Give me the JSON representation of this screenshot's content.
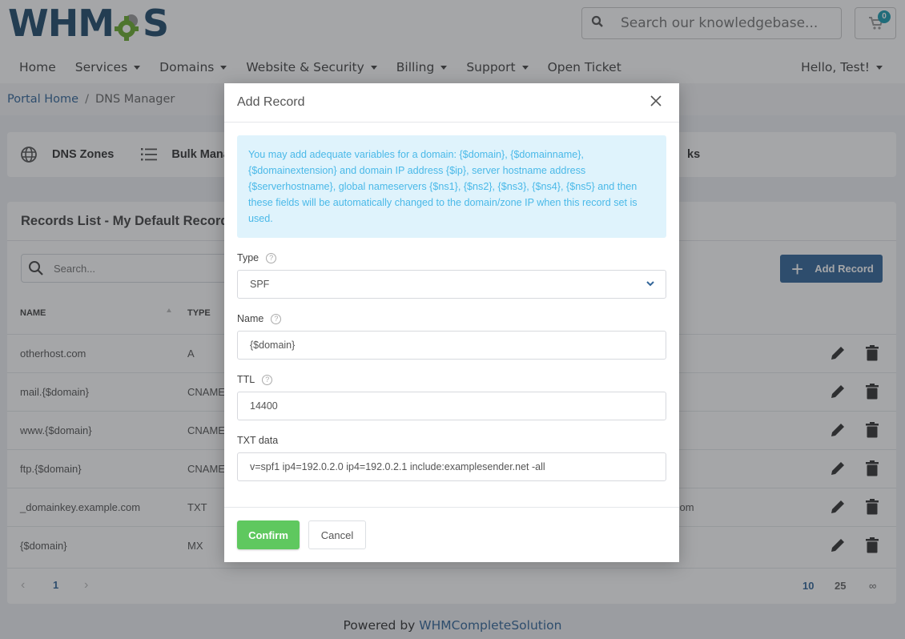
{
  "header": {
    "logo_text_left": "WHM",
    "logo_text_right": "S",
    "kb_search_placeholder": "Search our knowledgebase...",
    "cart_count": "0"
  },
  "nav": {
    "items": [
      {
        "label": "Home",
        "dropdown": false
      },
      {
        "label": "Services",
        "dropdown": true
      },
      {
        "label": "Domains",
        "dropdown": true
      },
      {
        "label": "Website & Security",
        "dropdown": true
      },
      {
        "label": "Billing",
        "dropdown": true
      },
      {
        "label": "Support",
        "dropdown": true
      },
      {
        "label": "Open Ticket",
        "dropdown": false
      }
    ],
    "user_label": "Hello, Test!"
  },
  "breadcrumb": {
    "home": "Portal Home",
    "separator": "/",
    "current": "DNS Manager"
  },
  "tabs": {
    "dns_zones": "DNS Zones",
    "bulk": "Bulk Manag",
    "right_partial": "ks"
  },
  "records": {
    "title": "Records List - My Default Record Se",
    "search_placeholder": "Search...",
    "add_button": "Add Record",
    "columns": {
      "name": "NAME",
      "type": "TYPE"
    },
    "rows": [
      {
        "name": "otherhost.com",
        "type": "A",
        "value": ""
      },
      {
        "name": "mail.{$domain}",
        "type": "CNAME",
        "value": ""
      },
      {
        "name": "www.{$domain}",
        "type": "CNAME",
        "value": ""
      },
      {
        "name": "ftp.{$domain}",
        "type": "CNAME",
        "value": ""
      },
      {
        "name": "_domainkey.example.com",
        "type": "TXT",
        "value": "com"
      },
      {
        "name": "{$domain}",
        "type": "MX",
        "value": ""
      }
    ],
    "pagination": {
      "prev": "‹",
      "current_page": "1",
      "next": "›",
      "page_sizes": [
        "10",
        "25",
        "∞"
      ],
      "active_page_size": "10"
    }
  },
  "footer": {
    "prefix": "Powered by",
    "link": "WHMCompleteSolution"
  },
  "modal": {
    "title": "Add Record",
    "info": "You may add adequate variables for a domain: {$domain}, {$domainname}, {$domainextension} and domain IP address {$ip}, server hostname address {$serverhostname}, global nameservers {$ns1}, {$ns2}, {$ns3}, {$ns4}, {$ns5} and then these fields will be automatically changed to the domain/zone IP when this record set is used.",
    "fields": {
      "type": {
        "label": "Type",
        "value": "SPF"
      },
      "name": {
        "label": "Name",
        "value": "{$domain}"
      },
      "ttl": {
        "label": "TTL",
        "value": "14400"
      },
      "txt": {
        "label": "TXT data",
        "value": "v=spf1 ip4=192.0.2.0 ip4=192.0.2.1 include:examplesender.net -all"
      }
    },
    "confirm": "Confirm",
    "cancel": "Cancel"
  },
  "colors": {
    "brand": "#336699",
    "confirm": "#5fc85f",
    "info_bg": "#dff3fc",
    "info_text": "#4ab9e8",
    "badge": "#1a9bb0"
  }
}
